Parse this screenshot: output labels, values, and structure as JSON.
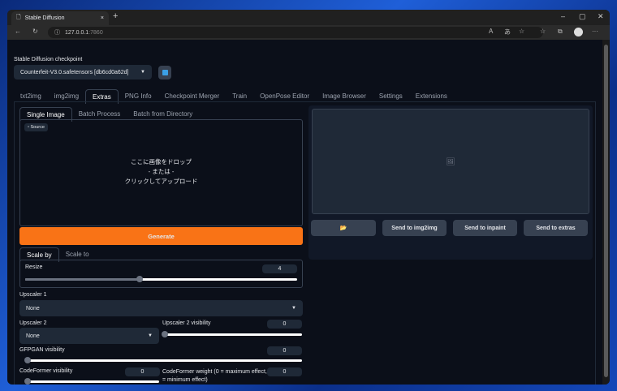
{
  "browser": {
    "tab_title": "Stable Diffusion",
    "url_host": "127.0.0.1",
    "url_port": ":7860"
  },
  "checkpoint": {
    "label": "Stable Diffusion checkpoint",
    "value": "Counterfeit-V3.0.safetensors [db6cd0a62d]"
  },
  "main_tabs": [
    "txt2img",
    "img2img",
    "Extras",
    "PNG Info",
    "Checkpoint Merger",
    "Train",
    "OpenPose Editor",
    "Image Browser",
    "Settings",
    "Extensions"
  ],
  "sub_tabs": [
    "Single Image",
    "Batch Process",
    "Batch from Directory"
  ],
  "source": {
    "label": "Source",
    "drop1": "ここに画像をドロップ",
    "drop2": "- または -",
    "drop3": "クリックしてアップロード"
  },
  "generate": "Generate",
  "scale_tabs": [
    "Scale by",
    "Scale to"
  ],
  "resize": {
    "label": "Resize",
    "value": "4",
    "fraction": 0.42
  },
  "upscaler1": {
    "label": "Upscaler 1",
    "value": "None"
  },
  "upscaler2": {
    "label": "Upscaler 2",
    "value": "None"
  },
  "upscaler2_vis": {
    "label": "Upscaler 2 visibility",
    "value": "0"
  },
  "gfpgan": {
    "label": "GFPGAN visibility",
    "value": "0"
  },
  "codeformer_vis": {
    "label": "CodeFormer visibility",
    "value": "0"
  },
  "codeformer_weight": {
    "label1": "CodeFormer weight (0 = maximum effect, 1",
    "label2": "= minimum effect)",
    "value": "0"
  },
  "output_buttons": [
    "📂",
    "Send to img2img",
    "Send to inpaint",
    "Send to extras"
  ],
  "colors": {
    "accent": "#f97316",
    "bg": "#0b0f19"
  }
}
